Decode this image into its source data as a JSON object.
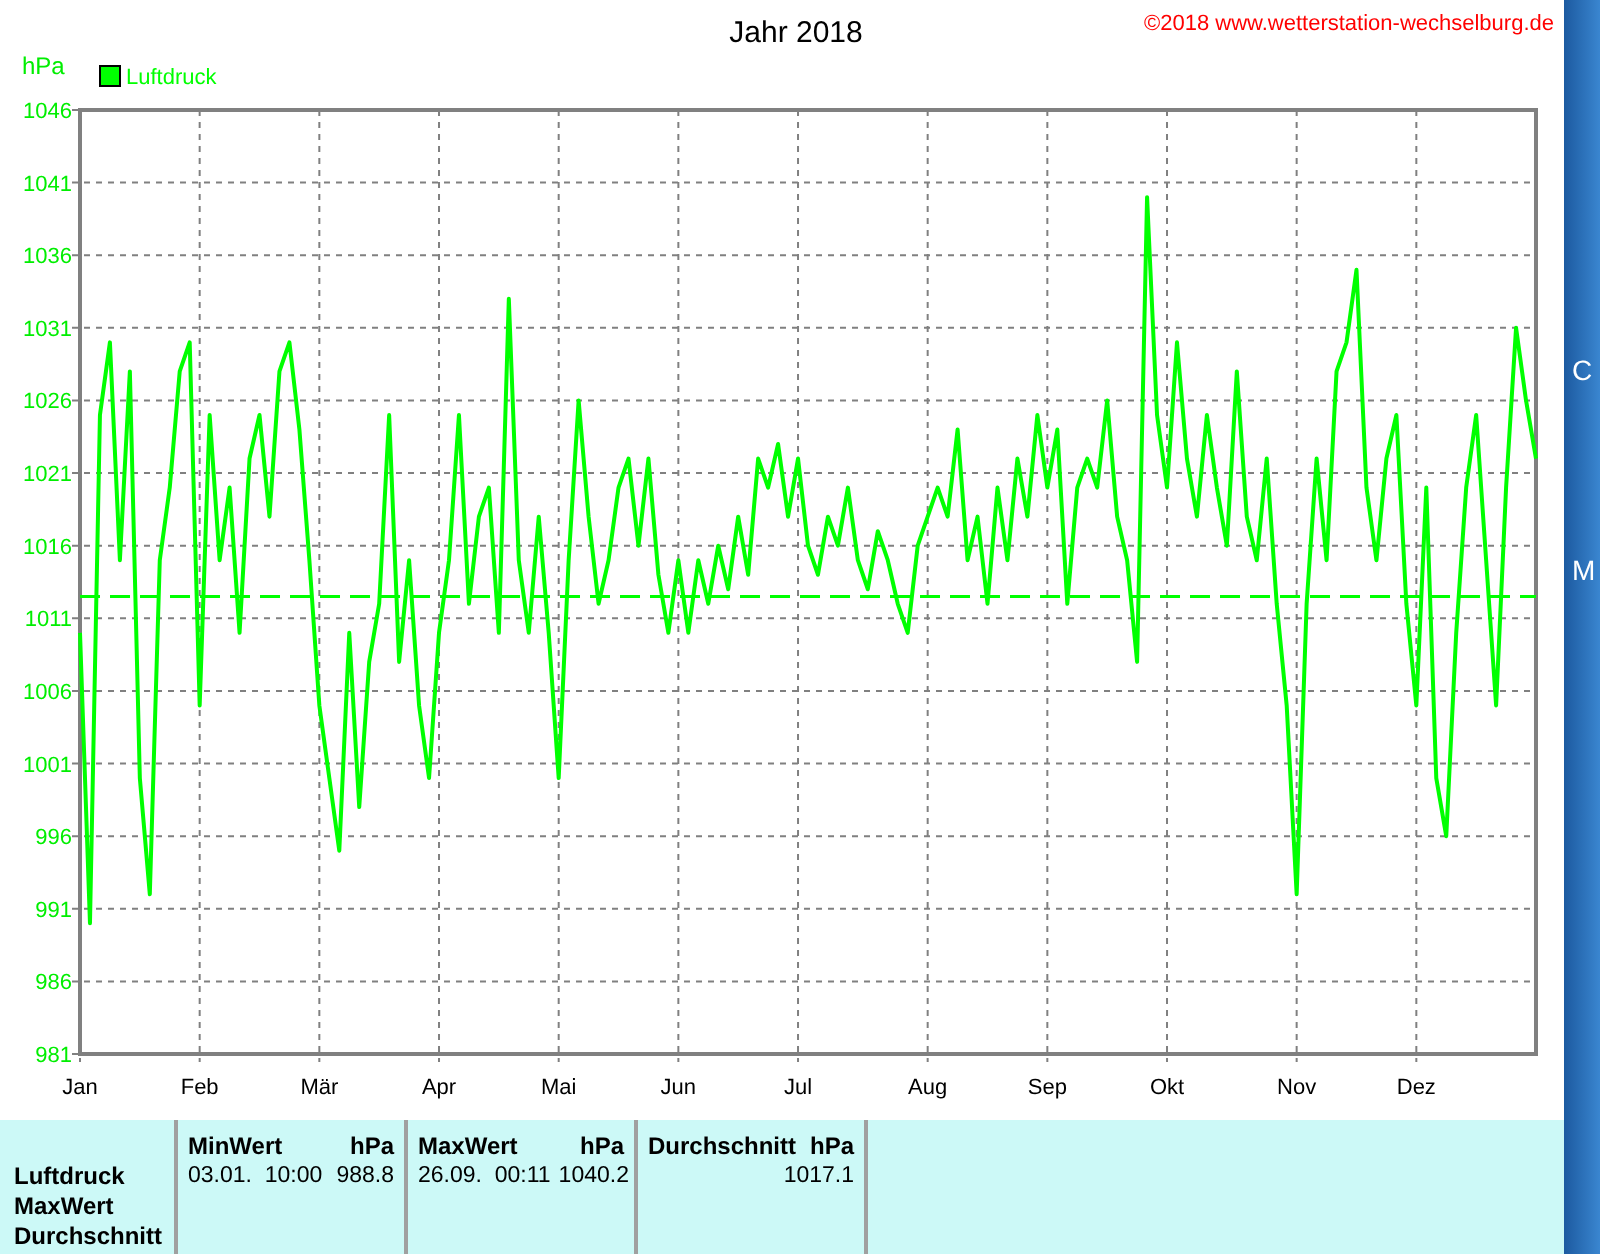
{
  "chart": {
    "title": "Jahr 2018",
    "copyright": "©2018 www.wetterstation-wechselburg.de",
    "y_unit": "hPa",
    "chart_data": {
      "type": "line",
      "grid": true,
      "categories": [
        "Jan",
        null,
        null,
        null,
        null,
        null,
        null,
        null,
        null,
        null,
        null,
        null,
        "Feb",
        null,
        null,
        null,
        null,
        null,
        null,
        null,
        null,
        null,
        null,
        null,
        "Mär",
        null,
        null,
        null,
        null,
        null,
        null,
        null,
        null,
        null,
        null,
        null,
        "Apr",
        null,
        null,
        null,
        null,
        null,
        null,
        null,
        null,
        null,
        null,
        null,
        "Mai",
        null,
        null,
        null,
        null,
        null,
        null,
        null,
        null,
        null,
        null,
        null,
        "Jun",
        null,
        null,
        null,
        null,
        null,
        null,
        null,
        null,
        null,
        null,
        null,
        "Jul",
        null,
        null,
        null,
        null,
        null,
        null,
        null,
        null,
        null,
        null,
        null,
        null,
        "Aug",
        null,
        null,
        null,
        null,
        null,
        null,
        null,
        null,
        null,
        null,
        null,
        "Sep",
        null,
        null,
        null,
        null,
        null,
        null,
        null,
        null,
        null,
        null,
        null,
        "Okt",
        null,
        null,
        null,
        null,
        null,
        null,
        null,
        null,
        null,
        null,
        null,
        null,
        "Nov",
        null,
        null,
        null,
        null,
        null,
        null,
        null,
        null,
        null,
        null,
        null,
        "Dez",
        null,
        null,
        null,
        null,
        null,
        null,
        null,
        null,
        null,
        null,
        null,
        null
      ],
      "ylim": [
        981,
        1046
      ],
      "yticks": [
        981,
        986,
        991,
        996,
        1001,
        1006,
        1011,
        1016,
        1021,
        1026,
        1031,
        1036,
        1041,
        1046
      ],
      "series": [
        {
          "name": "Luftdruck",
          "color": "#00ff00",
          "values": [
            1010,
            990,
            1025,
            1030,
            1015,
            1028,
            1000,
            992,
            1015,
            1020,
            1028,
            1030,
            1005,
            1025,
            1015,
            1020,
            1010,
            1022,
            1025,
            1018,
            1028,
            1030,
            1024,
            1015,
            1005,
            1000,
            995,
            1010,
            998,
            1008,
            1012,
            1025,
            1008,
            1015,
            1005,
            1000,
            1010,
            1015,
            1025,
            1012,
            1018,
            1020,
            1010,
            1033,
            1015,
            1010,
            1018,
            1010,
            1000,
            1015,
            1026,
            1018,
            1012,
            1015,
            1020,
            1022,
            1016,
            1022,
            1014,
            1010,
            1015,
            1010,
            1015,
            1012,
            1016,
            1013,
            1018,
            1014,
            1022,
            1020,
            1023,
            1018,
            1022,
            1016,
            1014,
            1018,
            1016,
            1020,
            1015,
            1013,
            1017,
            1015,
            1012,
            1010,
            1016,
            1018,
            1020,
            1018,
            1024,
            1015,
            1018,
            1012,
            1020,
            1015,
            1022,
            1018,
            1025,
            1020,
            1024,
            1012,
            1020,
            1022,
            1020,
            1026,
            1018,
            1015,
            1008,
            1040,
            1025,
            1020,
            1030,
            1022,
            1018,
            1025,
            1020,
            1016,
            1028,
            1018,
            1015,
            1022,
            1012,
            1005,
            992,
            1012,
            1022,
            1015,
            1028,
            1030,
            1035,
            1020,
            1015,
            1022,
            1025,
            1012,
            1005,
            1020,
            1000,
            996,
            1010,
            1020,
            1025,
            1015,
            1005,
            1020,
            1031,
            1026,
            1022
          ]
        }
      ],
      "ref_lines": [
        {
          "axis": "y",
          "value": 1012.5
        }
      ]
    }
  },
  "table": {
    "row_labels": [
      "Luftdruck",
      "MaxWert",
      "Durchschnitt"
    ],
    "columns": [
      {
        "header": "MinWert",
        "unit": "hPa",
        "time": "03.01.  10:00",
        "value": "988.8"
      },
      {
        "header": "MaxWert",
        "unit": "hPa",
        "time": "26.09.  00:11",
        "value": "1040.2"
      },
      {
        "header": "Durchschnitt",
        "unit": "hPa",
        "value": "1017.1"
      }
    ]
  },
  "background_window": {
    "texts": [
      "C",
      "M"
    ]
  }
}
